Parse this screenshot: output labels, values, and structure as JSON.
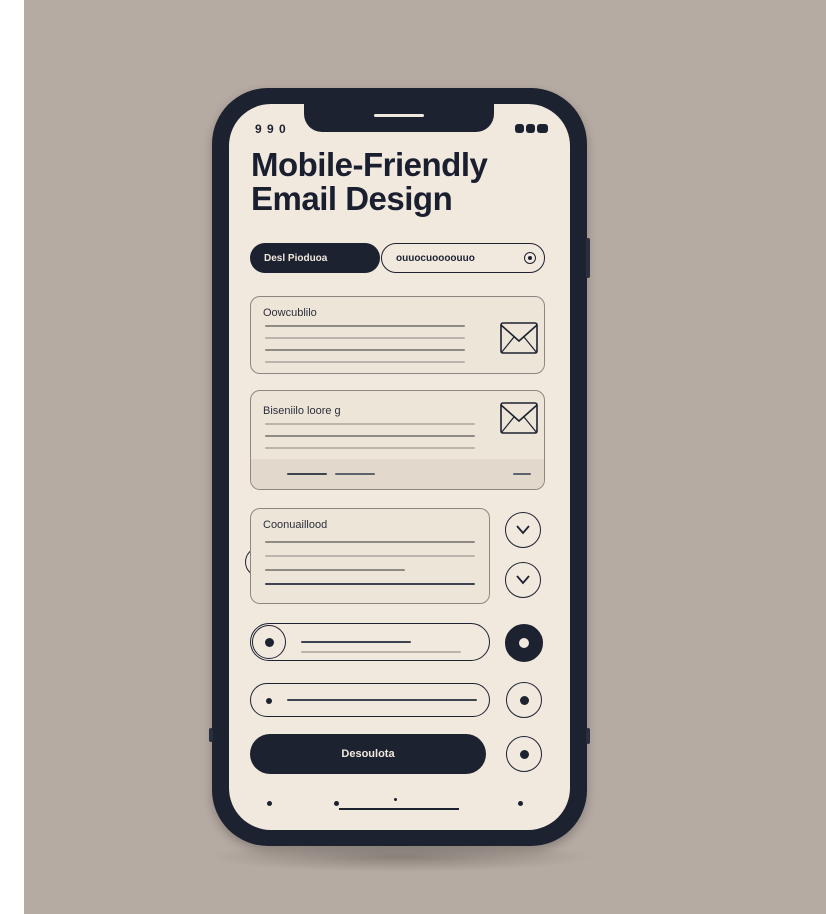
{
  "status": {
    "left": "9 9 0"
  },
  "header": {
    "title_line1": "Mobile-Friendly",
    "title_line2": "Email Design"
  },
  "pills": [
    {
      "label": "Desl Pioduoa",
      "style": "filled"
    },
    {
      "label": "ouuocuoooouuo",
      "style": "outline"
    }
  ],
  "cards": [
    {
      "label": "Oowcublilo"
    },
    {
      "label": "Biseniilo loore g"
    },
    {
      "label": "Coonuaillood"
    }
  ],
  "cta": {
    "label": "Desoulota"
  },
  "colors": {
    "phone": "#1d2231",
    "screen": "#f1e9de",
    "background": "#b6aba3",
    "line": "#8e8a85"
  },
  "icons": {
    "envelope": "envelope-icon",
    "chevron": "chevron-down-icon",
    "radio": "radio-dot-icon"
  }
}
